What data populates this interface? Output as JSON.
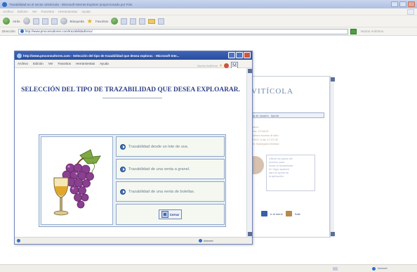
{
  "background_window": {
    "title": "Trazabilidad en el sector vitivinícola - Microsoft Internet Explorer proporcionado por Fóni",
    "menu": [
      "Archivo",
      "Edición",
      "Ver",
      "Favoritos",
      "Herramientas",
      "Ayuda"
    ],
    "toolbar": {
      "back_label": "Atrás",
      "search_label": "Búsqueda",
      "favorites_label": "Favoritos"
    },
    "address": {
      "label": "Dirección",
      "value": "http://www.pmconsultores.com/trazabilidad/vino/",
      "right_label": "Norton AntiVirus"
    },
    "page": {
      "brand": "VITÍCOLA",
      "nav": [
        "Alta de usuario",
        "Ayuda"
      ],
      "info_lines": [
        "Usuario:",
        "Fecha: 27/10/07",
        "Tu último acceso al sitio:",
        "27/10/07 a las 17:37:05",
        "Nivel: Bodeguero/Gestor"
      ],
      "note_lines": [
        "Ultima los pasos del",
        "proceso para",
        "trazar la trazabilidad",
        "En Vigor aparece",
        "aquí la ayuda de",
        "la aplicación"
      ],
      "links": [
        "Ir al menú",
        "Salir"
      ]
    },
    "status": {
      "zone": "Internet"
    }
  },
  "popup": {
    "title": "http://www.pmconsultores.com - Selección del tipo de trazabilidad que desea explorar. - Microsoft Inte...",
    "menu": [
      "Archivo",
      "Edición",
      "Ver",
      "Favoritos",
      "Herramientas",
      "Ayuda"
    ],
    "menu_right_label": "Norton AntiVirus",
    "heading": "SELECCIÓN DEL TIPO DE TRAZABILIDAD QUE DESEA EXPLOARAR.",
    "options": [
      {
        "label": "Trazabilidad desde un lote de uva."
      },
      {
        "label": "Trazabilidad de una venta a granel."
      },
      {
        "label": "Trazabilidad de una venta de botellas."
      }
    ],
    "close_label": "Cerrar",
    "status": {
      "zone": "Internet"
    }
  }
}
